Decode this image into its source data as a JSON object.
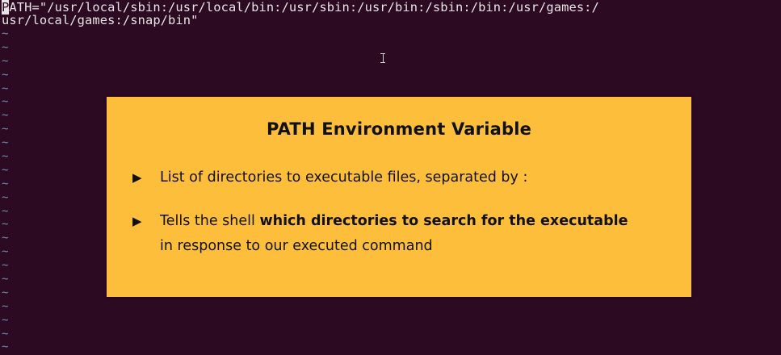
{
  "terminal": {
    "line1_cursor_char": "P",
    "line1_rest": "ATH=\"/usr/local/sbin:/usr/local/bin:/usr/sbin:/usr/bin:/sbin:/bin:/usr/games:/",
    "line2": "usr/local/games:/snap/bin\"",
    "tilde": "~",
    "colors": {
      "background": "#2c0a22",
      "text": "#e8e4e6",
      "tilde": "#6f8ca8"
    }
  },
  "overlay": {
    "title": "PATH  Environment Variable",
    "bullet_symbol": "▶",
    "bullet1": "List of directories to executable files, separated by :",
    "bullet2_prefix": "Tells the shell ",
    "bullet2_bold": "which directories to search for the executable",
    "bullet2_line2": "in response to our executed command",
    "colors": {
      "background": "#fdbe3b",
      "text": "#111111"
    }
  }
}
